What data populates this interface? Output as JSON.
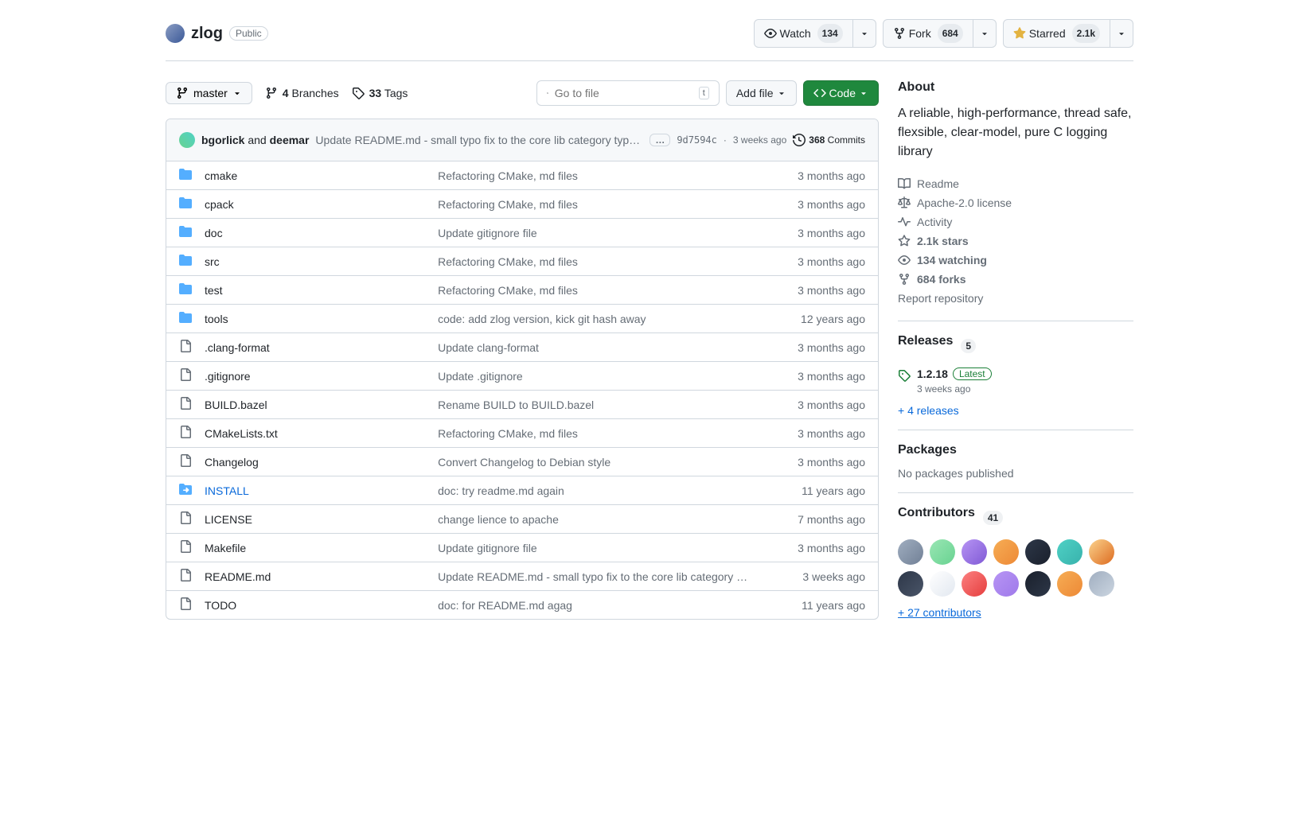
{
  "repo": {
    "name": "zlog",
    "visibility": "Public"
  },
  "actions": {
    "watch": {
      "label": "Watch",
      "count": "134"
    },
    "fork": {
      "label": "Fork",
      "count": "684"
    },
    "star": {
      "label": "Starred",
      "count": "2.1k"
    }
  },
  "branch": {
    "current": "master",
    "branches_count": "4",
    "branches_label": "Branches",
    "tags_count": "33",
    "tags_label": "Tags"
  },
  "search": {
    "placeholder": "Go to file",
    "shortcut": "t"
  },
  "add_file": "Add file",
  "code_btn": "Code",
  "commit_bar": {
    "author1": "bgorlick",
    "and": "and",
    "author2": "deemar",
    "message": "Update README.md - small typo fix to the core lib category type…",
    "sha": "9d7594c",
    "date": "3 weeks ago",
    "commits_count": "368",
    "commits_label": "Commits"
  },
  "files": [
    {
      "type": "dir",
      "name": "cmake",
      "msg": "Refactoring CMake, md files",
      "date": "3 months ago"
    },
    {
      "type": "dir",
      "name": "cpack",
      "msg": "Refactoring CMake, md files",
      "date": "3 months ago"
    },
    {
      "type": "dir",
      "name": "doc",
      "msg": "Update gitignore file",
      "date": "3 months ago"
    },
    {
      "type": "dir",
      "name": "src",
      "msg": "Refactoring CMake, md files",
      "date": "3 months ago"
    },
    {
      "type": "dir",
      "name": "test",
      "msg": "Refactoring CMake, md files",
      "date": "3 months ago"
    },
    {
      "type": "dir",
      "name": "tools",
      "msg": "code: add zlog version, kick git hash away",
      "date": "12 years ago"
    },
    {
      "type": "file",
      "name": ".clang-format",
      "msg": "Update clang-format",
      "date": "3 months ago"
    },
    {
      "type": "file",
      "name": ".gitignore",
      "msg": "Update .gitignore",
      "date": "3 months ago"
    },
    {
      "type": "file",
      "name": "BUILD.bazel",
      "msg": "Rename BUILD to BUILD.bazel",
      "date": "3 months ago"
    },
    {
      "type": "file",
      "name": "CMakeLists.txt",
      "msg": "Refactoring CMake, md files",
      "date": "3 months ago"
    },
    {
      "type": "file",
      "name": "Changelog",
      "msg": "Convert Changelog to Debian style",
      "date": "3 months ago"
    },
    {
      "type": "symlink",
      "name": "INSTALL",
      "msg": "doc: try readme.md again",
      "date": "11 years ago"
    },
    {
      "type": "file",
      "name": "LICENSE",
      "msg": "change lience to apache",
      "date": "7 months ago"
    },
    {
      "type": "file",
      "name": "Makefile",
      "msg": "Update gitignore file",
      "date": "3 months ago"
    },
    {
      "type": "file",
      "name": "README.md",
      "msg": "Update README.md - small typo fix to the core lib category …",
      "date": "3 weeks ago"
    },
    {
      "type": "file",
      "name": "TODO",
      "msg": "doc: for README.md agag",
      "date": "11 years ago"
    }
  ],
  "about": {
    "title": "About",
    "description": "A reliable, high-performance, thread safe, flexsible, clear-model, pure C logging library",
    "items": {
      "readme": "Readme",
      "license": "Apache-2.0 license",
      "activity": "Activity",
      "stars": "2.1k stars",
      "watching": "134 watching",
      "forks": "684 forks",
      "report": "Report repository"
    }
  },
  "releases": {
    "title": "Releases",
    "count": "5",
    "latest_version": "1.2.18",
    "latest_label": "Latest",
    "latest_date": "3 weeks ago",
    "more": "+ 4 releases"
  },
  "packages": {
    "title": "Packages",
    "none": "No packages published"
  },
  "contributors": {
    "title": "Contributors",
    "count": "41",
    "more": "+ 27 contributors",
    "avatars": [
      "linear-gradient(135deg,#a0aec0,#718096)",
      "linear-gradient(135deg,#9ae6b4,#68d391)",
      "linear-gradient(135deg,#b794f4,#805ad5)",
      "linear-gradient(135deg,#f6ad55,#ed8936)",
      "linear-gradient(135deg,#2d3748,#1a202c)",
      "linear-gradient(135deg,#4fd1c5,#38b2ac)",
      "linear-gradient(135deg,#fbd38d,#dd6b20)",
      "linear-gradient(135deg,#2d3748,#4a5568)",
      "linear-gradient(135deg,#fff,#e2e8f0)",
      "linear-gradient(135deg,#fc8181,#e53e3e)",
      "linear-gradient(135deg,#b794f4,#9f7aea)",
      "linear-gradient(135deg,#1a202c,#2d3748)",
      "linear-gradient(135deg,#f6ad55,#ed8936)",
      "linear-gradient(135deg,#a0aec0,#cbd5e0)"
    ]
  }
}
